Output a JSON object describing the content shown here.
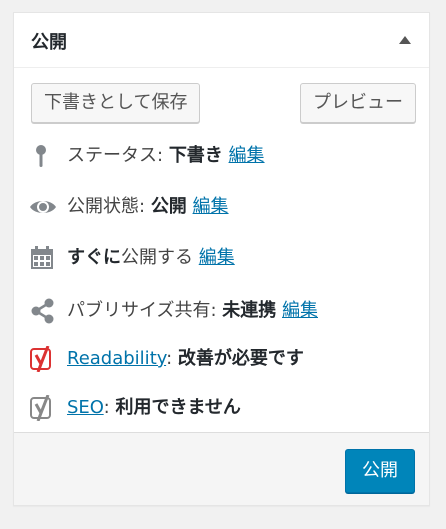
{
  "box": {
    "title": "公開"
  },
  "actions": {
    "save_draft": "下書きとして保存",
    "preview": "プレビュー"
  },
  "status": {
    "label": "ステータス:",
    "value": "下書き",
    "edit": "編集"
  },
  "visibility": {
    "label": "公開状態:",
    "value": "公開",
    "edit": "編集"
  },
  "schedule": {
    "when": "すぐに",
    "label": "公開する",
    "edit": "編集"
  },
  "sharing": {
    "label": "パブリサイズ共有:",
    "value": "未連携",
    "edit": "編集"
  },
  "readability": {
    "link": "Readability",
    "sep": ":",
    "value": "改善が必要です",
    "color": "#dc3232"
  },
  "seo": {
    "link": "SEO",
    "sep": ":",
    "value": "利用できません",
    "color": "#888888"
  },
  "footer": {
    "publish": "公開"
  },
  "colors": {
    "accent": "#0073aa",
    "primary": "#0085ba"
  }
}
